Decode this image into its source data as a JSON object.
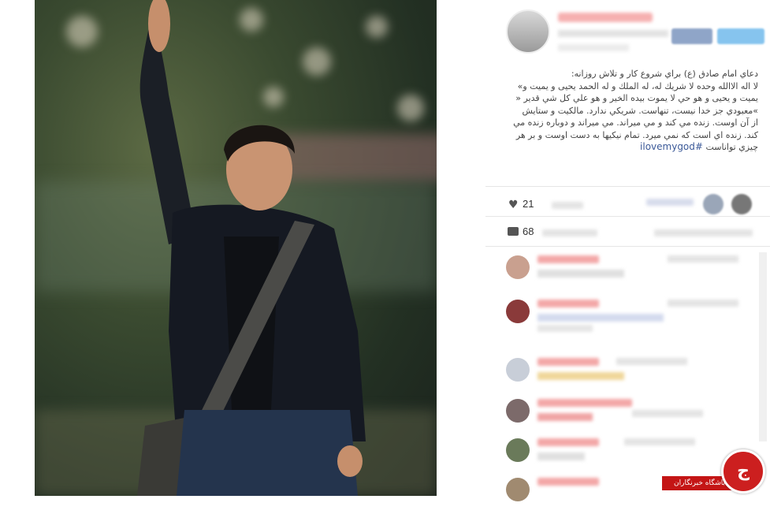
{
  "post": {
    "caption_lines": [
      "دعاي امام صادق (ع) براي شروع كار و تلاش روزانه:",
      "لا اله الاالله وحده لا شريك له، له الملك و له الحمد يحيى و يميت و»",
      "يميت و يحيى و هو حي لا يموت بيده الخير و هو علي كل شي قدير «",
      "»معبودي جز خدا نيست، تنهاست. شريكي ندارد. مالكيت و ستايش",
      "از آن اوست. زنده مي كند و مي ميراند. مي ميراند و دوباره زنده مي",
      "كند. زنده اي است كه نمي ميرد. تمام نيكيها به دست اوست و بر هر",
      "چيزي تواناست"
    ],
    "hashtag": "#ilovemygod",
    "likes_prefix": "21",
    "comments_prefix": "68"
  },
  "badge": {
    "strip_text": "باشگاه خبرنگاران",
    "circle_letter": "ج"
  },
  "colors": {
    "hashtag": "#3b5998",
    "badge_red": "#c41515"
  },
  "icons": [
    "heart-icon",
    "comment-icon",
    "logo-icon"
  ]
}
